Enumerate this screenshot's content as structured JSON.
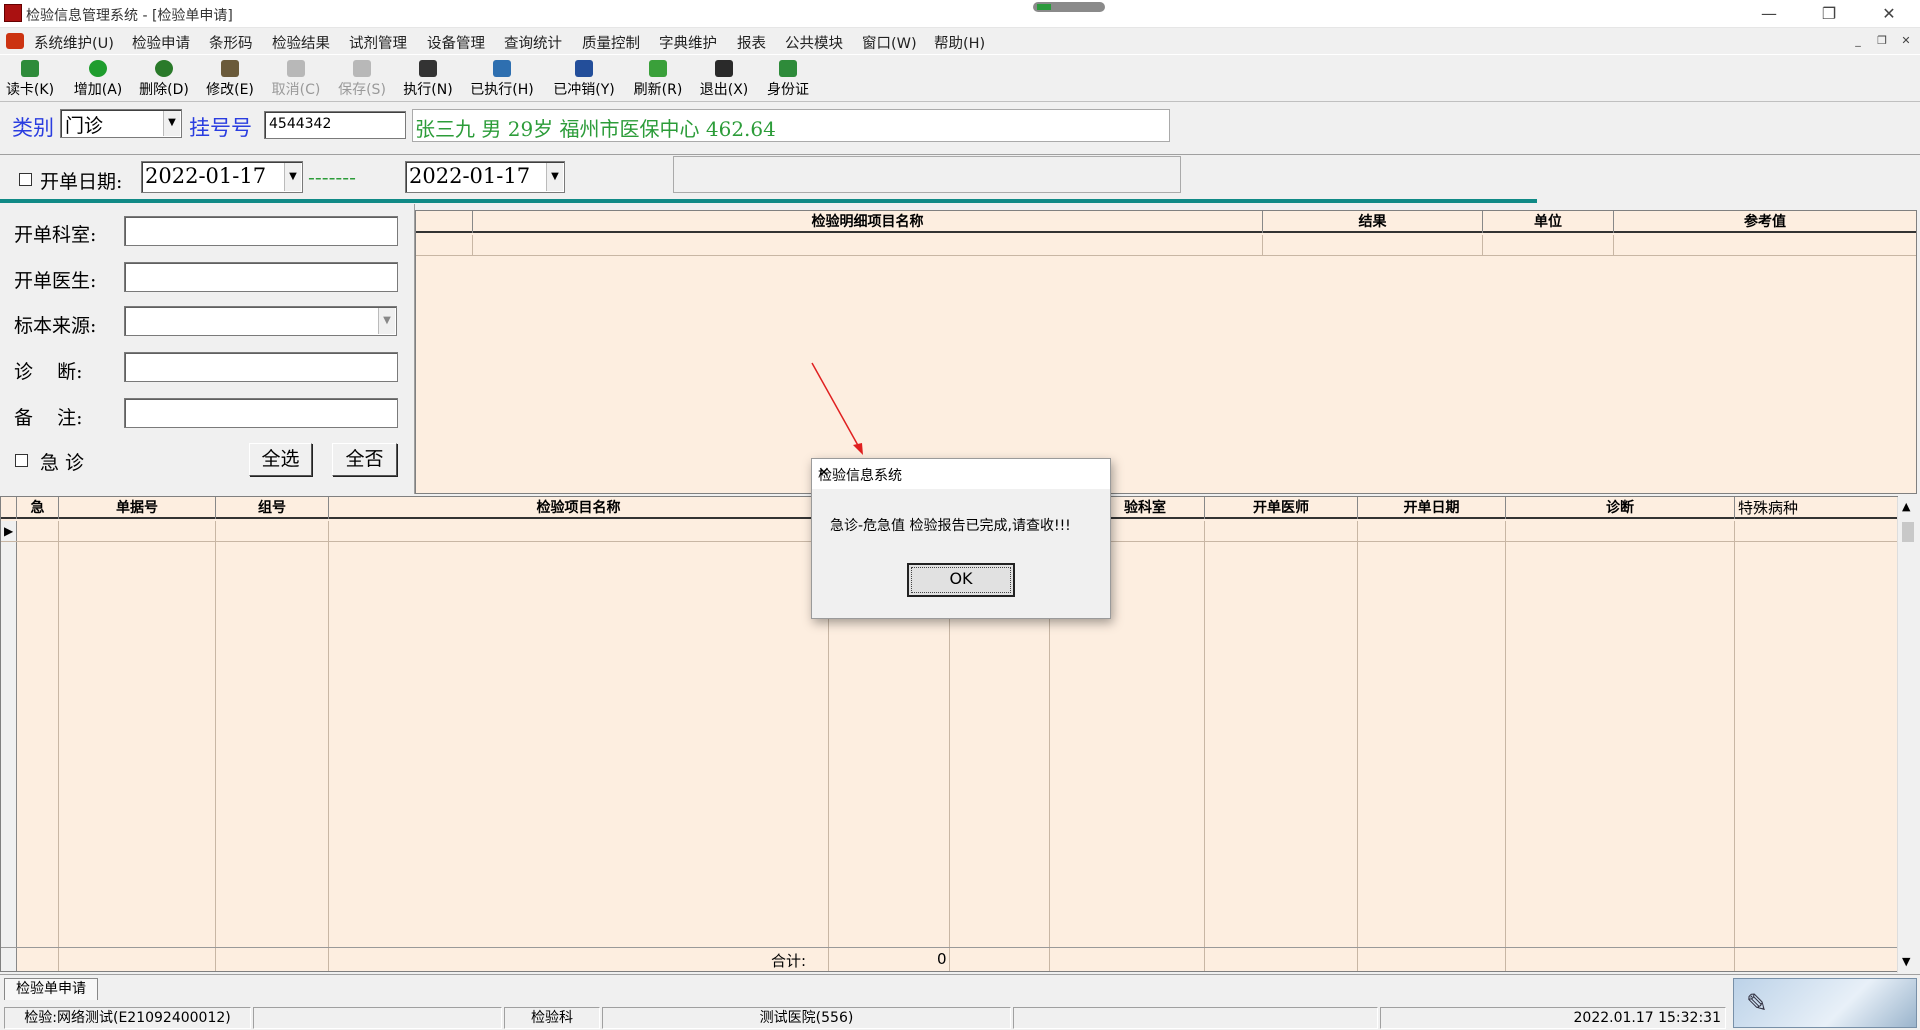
{
  "window": {
    "title": "检验信息管理系统 - [检验单申请]"
  },
  "menu": [
    "系统维护(U)",
    "检验申请",
    "条形码",
    "检验结果",
    "试剂管理",
    "设备管理",
    "查询统计",
    "质量控制",
    "字典维护",
    "报表",
    "公共模块",
    "窗口(W)",
    "帮助(H)"
  ],
  "toolbar": [
    {
      "label": "读卡(K)",
      "enabled": true,
      "icon": "card-icon",
      "color": "#2e8b3a"
    },
    {
      "label": "增加(A)",
      "enabled": true,
      "icon": "add-icon",
      "color": "#1f9d2e"
    },
    {
      "label": "删除(D)",
      "enabled": true,
      "icon": "delete-icon",
      "color": "#2a7a2a"
    },
    {
      "label": "修改(E)",
      "enabled": true,
      "icon": "edit-icon",
      "color": "#6a5a3a"
    },
    {
      "label": "取消(C)",
      "enabled": false,
      "icon": "cancel-icon",
      "color": "#b0b0b0"
    },
    {
      "label": "保存(S)",
      "enabled": false,
      "icon": "save-icon",
      "color": "#b0b0b0"
    },
    {
      "label": "执行(N)",
      "enabled": true,
      "icon": "execute-icon",
      "color": "#333333"
    },
    {
      "label": "已执行(H)",
      "enabled": true,
      "icon": "executed-icon",
      "color": "#2e6fb0"
    },
    {
      "label": "已冲销(Y)",
      "enabled": true,
      "icon": "reversed-icon",
      "color": "#234e9a"
    },
    {
      "label": "刷新(R)",
      "enabled": true,
      "icon": "refresh-icon",
      "color": "#3aa03a"
    },
    {
      "label": "退出(X)",
      "enabled": true,
      "icon": "exit-icon",
      "color": "#2a2a2a"
    },
    {
      "label": "身份证",
      "enabled": true,
      "icon": "id-card-icon",
      "color": "#2e8b3a"
    }
  ],
  "patient": {
    "category_label": "类别",
    "category_value": "门诊",
    "reg_label": "挂号号",
    "reg_value": "4544342",
    "info": "张三九 男  29岁 福州市医保中心 462.64"
  },
  "dates": {
    "label": "开单日期:",
    "from": "2022-01-17",
    "dashes": "-------",
    "to": "2022-01-17"
  },
  "form": {
    "dept_label": "开单科室:",
    "doctor_label": "开单医生:",
    "specimen_label": "标本来源:",
    "diagnosis_label": "诊    断:",
    "remark_label": "备    注:",
    "urgent_label": "急 诊",
    "select_all": "全选",
    "select_none": "全否"
  },
  "detail_grid": {
    "columns": [
      "检验明细项目名称",
      "结果",
      "单位",
      "参考值"
    ]
  },
  "main_grid": {
    "columns": [
      "急",
      "单据号",
      "组号",
      "检验项目名称",
      "检验科室",
      "开单医师",
      "开单日期",
      "诊断",
      "特殊病种"
    ],
    "visible_header_fragment": "验科室",
    "total_label": "合计:",
    "total_value": "0"
  },
  "tab": "检验单申请",
  "status": {
    "user": "检验:网络测试(E21092400012)",
    "dept": "检验科",
    "hospital": "测试医院(556)",
    "datetime": "2022.01.17 15:32:31"
  },
  "dialog": {
    "title": "检验信息系统",
    "message": "急诊-危急值 检验报告已完成,请查收!!!",
    "ok": "OK"
  }
}
